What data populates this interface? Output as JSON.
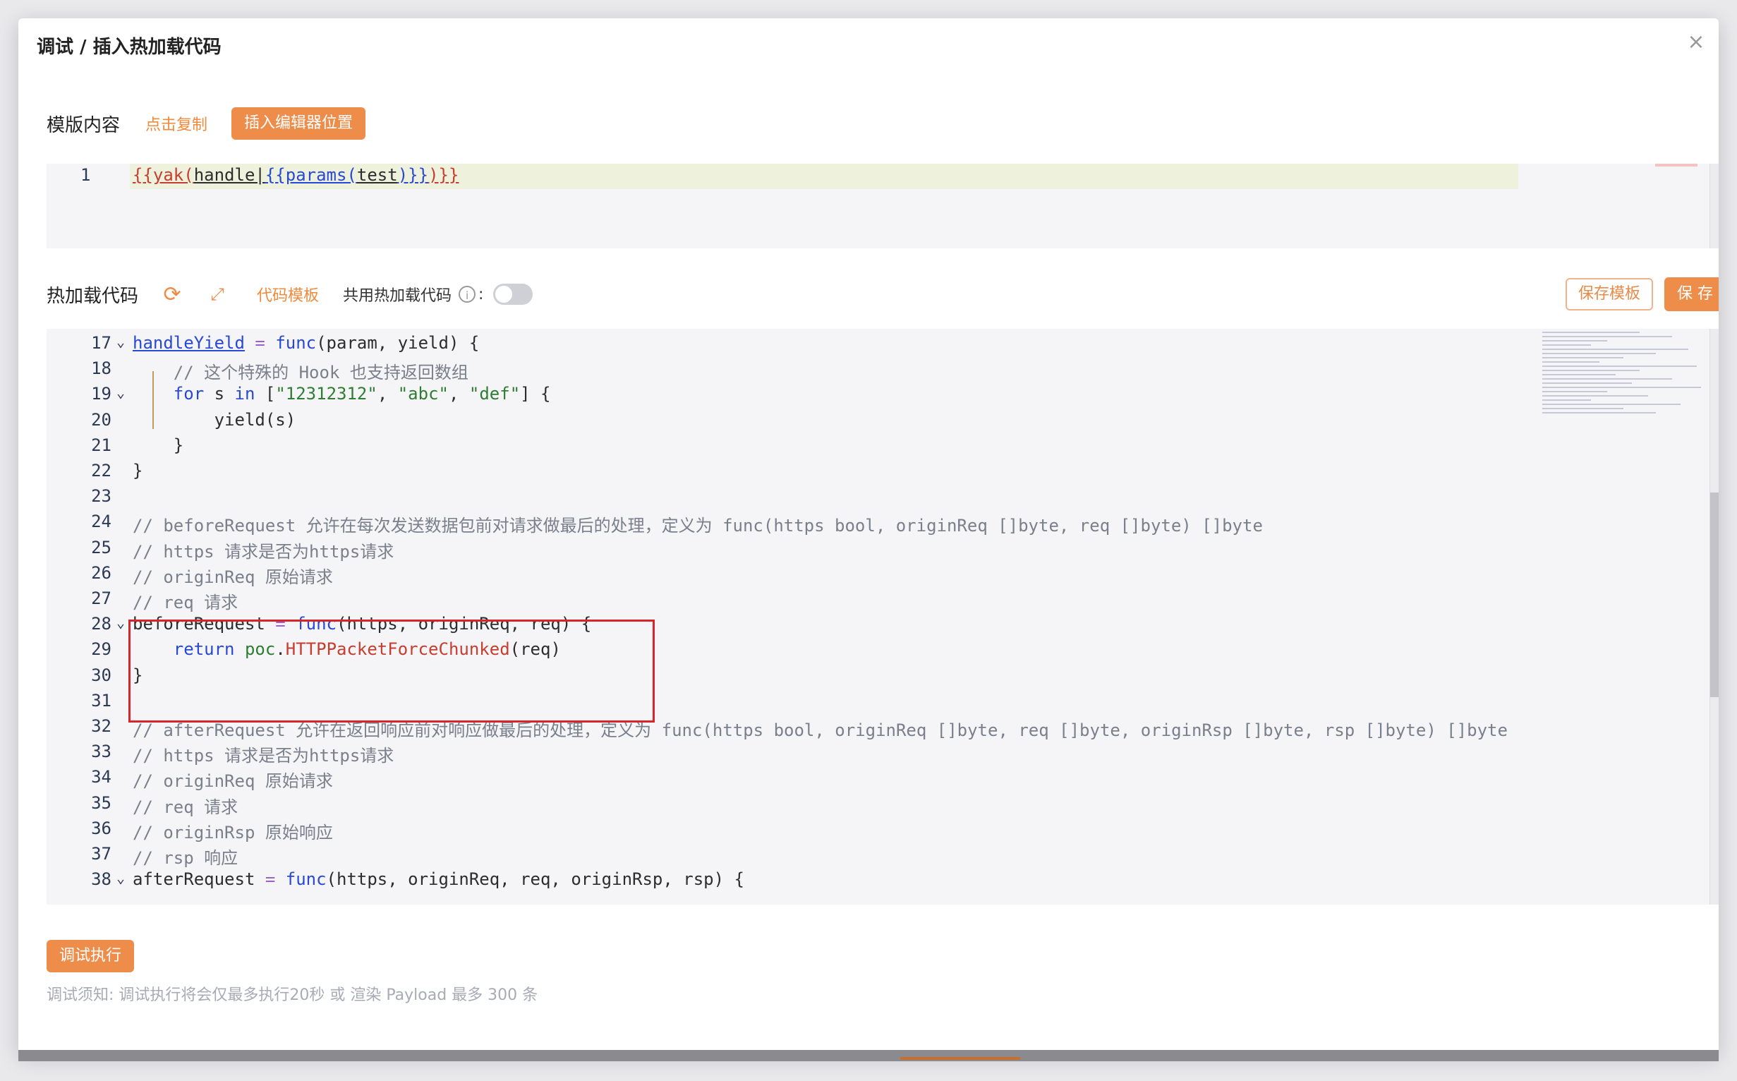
{
  "modal": {
    "title": "调试 / 插入热加载代码",
    "close_icon": "close-icon"
  },
  "template_section": {
    "label": "模版内容",
    "copy_label": "点击复制",
    "insert_label": "插入编辑器位置",
    "line_number": "1",
    "code": "{{yak(handle|{{params(test)}})}}"
  },
  "hotload_section": {
    "label": "热加载代码",
    "refresh_icon": "refresh-icon",
    "fullscreen_icon": "fullscreen-icon",
    "code_template_label": "代码模板",
    "shared_label": "共用热加载代码",
    "info_icon": "info-icon",
    "colon": ":",
    "shared_enabled": false,
    "save_template_label": "保存模板",
    "save_label": "保 存"
  },
  "code_editor": {
    "lines": [
      {
        "n": "17",
        "text": "handleYield = func(param, yield) {"
      },
      {
        "n": "18",
        "text": "    // 这个特殊的 Hook 也支持返回数组"
      },
      {
        "n": "19",
        "text": "    for s in [\"12312312\", \"abc\", \"def\"] {"
      },
      {
        "n": "20",
        "text": "        yield(s)"
      },
      {
        "n": "21",
        "text": "    }"
      },
      {
        "n": "22",
        "text": "}"
      },
      {
        "n": "23",
        "text": ""
      },
      {
        "n": "24",
        "text": "// beforeRequest 允许在每次发送数据包前对请求做最后的处理，定义为 func(https bool, originReq []byte, req []byte) []byte"
      },
      {
        "n": "25",
        "text": "// https 请求是否为https请求"
      },
      {
        "n": "26",
        "text": "// originReq 原始请求"
      },
      {
        "n": "27",
        "text": "// req 请求"
      },
      {
        "n": "28",
        "text": "beforeRequest = func(https, originReq, req) {"
      },
      {
        "n": "29",
        "text": "    return poc.HTTPPacketForceChunked(req)"
      },
      {
        "n": "30",
        "text": "}"
      },
      {
        "n": "31",
        "text": ""
      },
      {
        "n": "32",
        "text": "// afterRequest 允许在返回响应前对响应做最后的处理，定义为 func(https bool, originReq []byte, req []byte, originRsp []byte, rsp []byte) []byte"
      },
      {
        "n": "33",
        "text": "// https 请求是否为https请求"
      },
      {
        "n": "34",
        "text": "// originReq 原始请求"
      },
      {
        "n": "35",
        "text": "// req 请求"
      },
      {
        "n": "36",
        "text": "// originRsp 原始响应"
      },
      {
        "n": "37",
        "text": "// rsp 响应"
      },
      {
        "n": "38",
        "text": "afterRequest = func(https, originReq, req, originRsp, rsp) {"
      }
    ]
  },
  "footer": {
    "debug_label": "调试执行",
    "note": "调试须知: 调试执行将会仅最多执行20秒 或 渲染 Payload 最多 300 条"
  }
}
